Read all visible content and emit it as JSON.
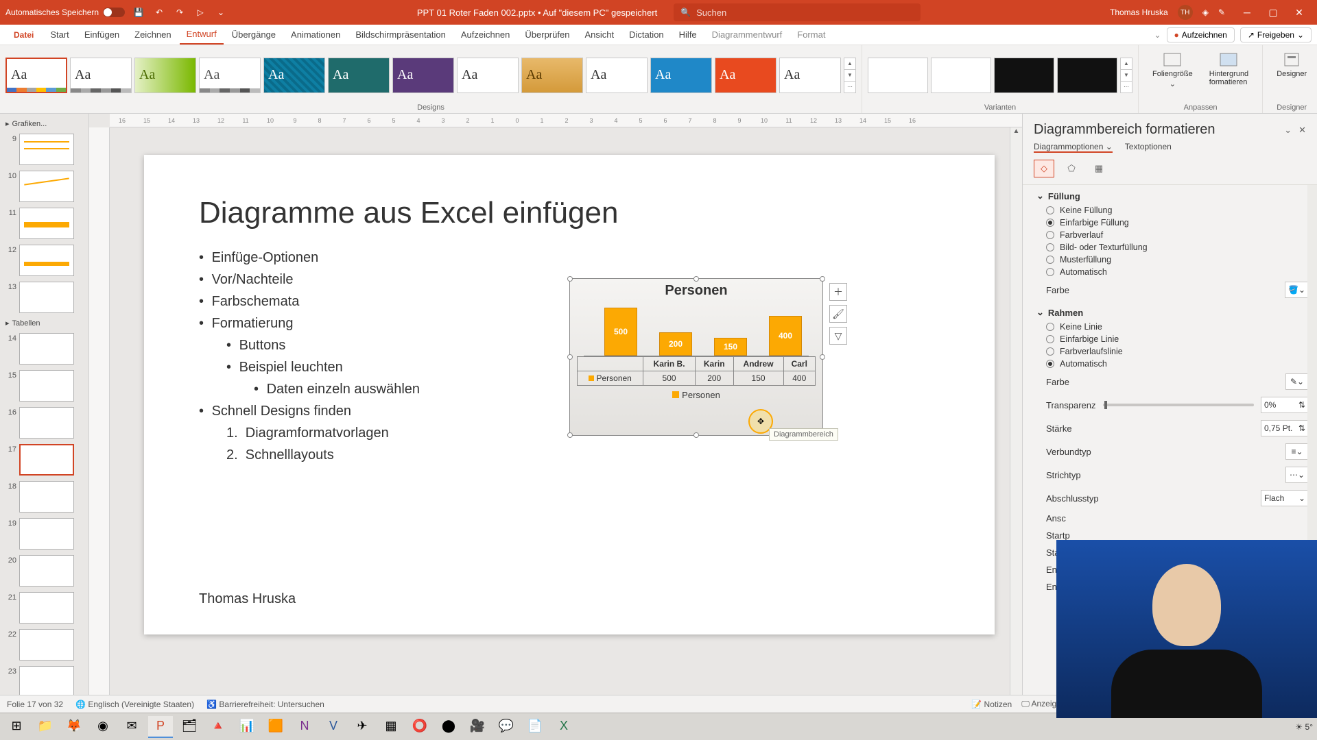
{
  "titlebar": {
    "autosave": "Automatisches Speichern",
    "doc": "PPT 01 Roter Faden 002.pptx • Auf \"diesem PC\" gespeichert",
    "search_placeholder": "Suchen",
    "user_name": "Thomas Hruska",
    "user_initials": "TH"
  },
  "tabs": {
    "file": "Datei",
    "items": [
      "Start",
      "Einfügen",
      "Zeichnen",
      "Entwurf",
      "Übergänge",
      "Animationen",
      "Bildschirmpräsentation",
      "Aufzeichnen",
      "Überprüfen",
      "Ansicht",
      "Dictation",
      "Hilfe",
      "Diagrammentwurf",
      "Format"
    ],
    "active_index": 3,
    "record": "Aufzeichnen",
    "share": "Freigeben"
  },
  "ribbon": {
    "designs_label": "Designs",
    "variants_label": "Varianten",
    "customize_label": "Anpassen",
    "slide_size": "Foliengröße",
    "bg_format": "Hintergrund formatieren",
    "designer_label": "Designer",
    "designer_btn": "Designer"
  },
  "slidepanel": {
    "section_graphics": "Grafiken...",
    "section_tables": "Tabellen",
    "slides": [
      9,
      10,
      11,
      12,
      13,
      13,
      14,
      15,
      16,
      17,
      18,
      19,
      20,
      21,
      22,
      23
    ],
    "current": 17
  },
  "ruler_h": [
    "16",
    "15",
    "14",
    "13",
    "12",
    "11",
    "10",
    "9",
    "8",
    "7",
    "6",
    "5",
    "4",
    "3",
    "2",
    "1",
    "0",
    "1",
    "2",
    "3",
    "4",
    "5",
    "6",
    "7",
    "8",
    "9",
    "10",
    "11",
    "12",
    "13",
    "14",
    "15",
    "16"
  ],
  "slide": {
    "title": "Diagramme aus Excel einfügen",
    "b1": "Einfüge-Optionen",
    "b2": "Vor/Nachteile",
    "b3": "Farbschemata",
    "b4": "Formatierung",
    "b4a": "Buttons",
    "b4b": "Beispiel leuchten",
    "b4b1": "Daten einzeln auswählen",
    "b5": "Schnell Designs finden",
    "b5n1": "Diagramformatvorlagen",
    "b5n2": "Schnelllayouts",
    "footer": "Thomas Hruska"
  },
  "chart_data": {
    "type": "bar",
    "title": "Personen",
    "series_name": "Personen",
    "categories": [
      "Karin B.",
      "Karin",
      "Andrew",
      "Carl"
    ],
    "values": [
      500,
      200,
      150,
      400
    ],
    "legend": "Personen",
    "tooltip": "Diagrammbereich"
  },
  "format_pane": {
    "title": "Diagrammbereich formatieren",
    "tab_chart": "Diagrammoptionen",
    "tab_text": "Textoptionen",
    "fill_section": "Füllung",
    "fill_none": "Keine Füllung",
    "fill_solid": "Einfarbige Füllung",
    "fill_gradient": "Farbverlauf",
    "fill_picture": "Bild- oder Texturfüllung",
    "fill_pattern": "Musterfüllung",
    "fill_auto": "Automatisch",
    "color_label": "Farbe",
    "border_section": "Rahmen",
    "line_none": "Keine Linie",
    "line_solid": "Einfarbige Linie",
    "line_gradient": "Farbverlaufslinie",
    "line_auto": "Automatisch",
    "transp": "Transparenz",
    "transp_val": "0%",
    "width": "Stärke",
    "width_val": "0,75 Pt.",
    "compound": "Verbundtyp",
    "dash": "Strichtyp",
    "cap": "Abschlusstyp",
    "cap_val": "Flach",
    "join_partial": "Ansc",
    "arrow_start_partial": "Startp",
    "arrow_startsize_partial": "Start",
    "arrow_end_partial": "Endp",
    "arrow_endsize_partial": "Endp"
  },
  "statusbar": {
    "slide_info": "Folie 17 von 32",
    "language": "Englisch (Vereinigte Staaten)",
    "accessibility": "Barrierefreiheit: Untersuchen",
    "notes": "Notizen",
    "display": "Anzeigeeinstellungen"
  },
  "taskbar": {
    "weather": "5°"
  }
}
